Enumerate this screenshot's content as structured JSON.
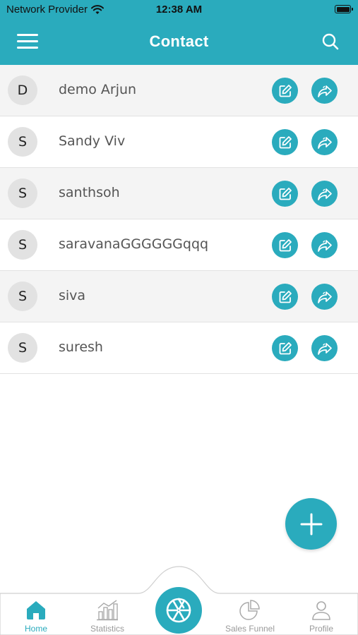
{
  "status_bar": {
    "carrier": "Network Provider",
    "time": "12:38 AM",
    "wifi_icon": "wifi-icon",
    "battery_icon": "battery-icon"
  },
  "header": {
    "title": "Contact",
    "menu_icon": "menu-icon",
    "search_icon": "search-icon"
  },
  "contacts": [
    {
      "initial": "D",
      "name": "demo Arjun"
    },
    {
      "initial": "S",
      "name": "Sandy Viv"
    },
    {
      "initial": "S",
      "name": "santhsoh"
    },
    {
      "initial": "S",
      "name": "saravanaGGGGGGqqq"
    },
    {
      "initial": "S",
      "name": "siva"
    },
    {
      "initial": "S",
      "name": "suresh"
    }
  ],
  "row_actions": {
    "edit_icon": "edit-icon",
    "share_icon": "share-icon"
  },
  "fab": {
    "icon": "plus-icon"
  },
  "bottom_nav": {
    "home": "Home",
    "statistics": "Statistics",
    "center_icon": "aperture-icon",
    "sales_funnel": "Sales Funnel",
    "profile": "Profile",
    "active": "Home"
  },
  "colors": {
    "accent": "#2aabbd",
    "row_alt": "#f4f4f4",
    "avatar_bg": "#e2e2e2",
    "nav_inactive": "#9a9a9a"
  }
}
